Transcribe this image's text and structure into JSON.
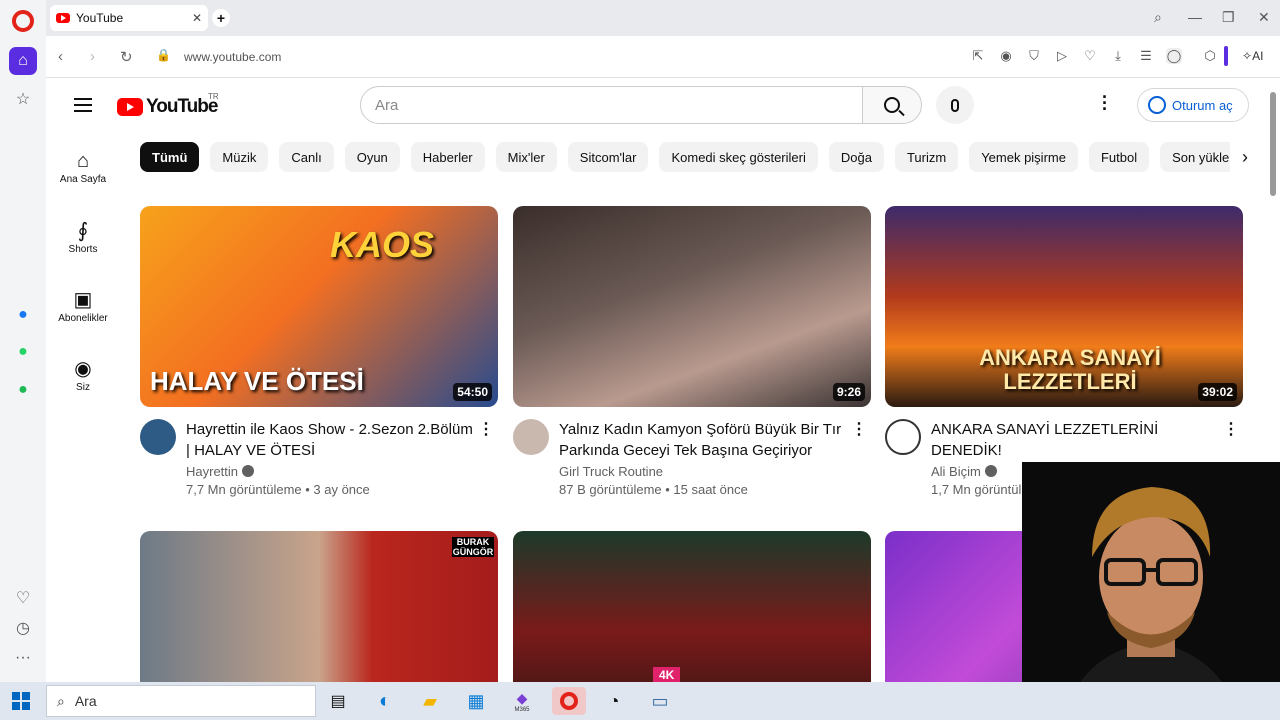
{
  "browser": {
    "tab_title": "YouTube",
    "url": "www.youtube.com",
    "ai_label": "AI"
  },
  "youtube": {
    "logo_text": "YouTube",
    "logo_region": "TR",
    "search_placeholder": "Ara",
    "signin_label": "Oturum aç",
    "guide": [
      {
        "label": "Ana Sayfa",
        "icon": "home-icon"
      },
      {
        "label": "Shorts",
        "icon": "shorts-icon"
      },
      {
        "label": "Abonelikler",
        "icon": "subscriptions-icon"
      },
      {
        "label": "Siz",
        "icon": "you-icon"
      }
    ],
    "chips": [
      "Tümü",
      "Müzik",
      "Canlı",
      "Oyun",
      "Haberler",
      "Mix'ler",
      "Sitcom'lar",
      "Komedi skeç gösterileri",
      "Doğa",
      "Turizm",
      "Yemek pişirme",
      "Futbol",
      "Son yüklen"
    ],
    "videos": [
      {
        "title": "Hayrettin ile Kaos Show - 2.Sezon 2.Bölüm | HALAY VE ÖTESİ",
        "channel": "Hayrettin",
        "stats": "7,7 Mn görüntüleme • 3 ay önce",
        "duration": "54:50",
        "thumb_text": "HALAY VE ÖTESİ",
        "thumb_brand": "KAOS"
      },
      {
        "title": "Yalnız Kadın Kamyon Şoförü Büyük Bir Tır Parkında Geceyi Tek Başına Geçiriyor",
        "channel": "Girl Truck Routine",
        "stats": "87 B görüntüleme • 15 saat önce",
        "duration": "9:26"
      },
      {
        "title": "ANKARA SANAYİ LEZZETLERİNİ DENEDİK!",
        "channel": "Ali Biçim",
        "stats": "1,7 Mn görüntül",
        "duration": "39:02",
        "thumb_text": "ANKARA SANAYİ LEZZETLERİ"
      }
    ],
    "row2_badges": [
      "BURAK GÜNGÖR",
      "4K"
    ]
  },
  "taskbar": {
    "search_placeholder": "Ara",
    "copilot_label": "M365"
  }
}
